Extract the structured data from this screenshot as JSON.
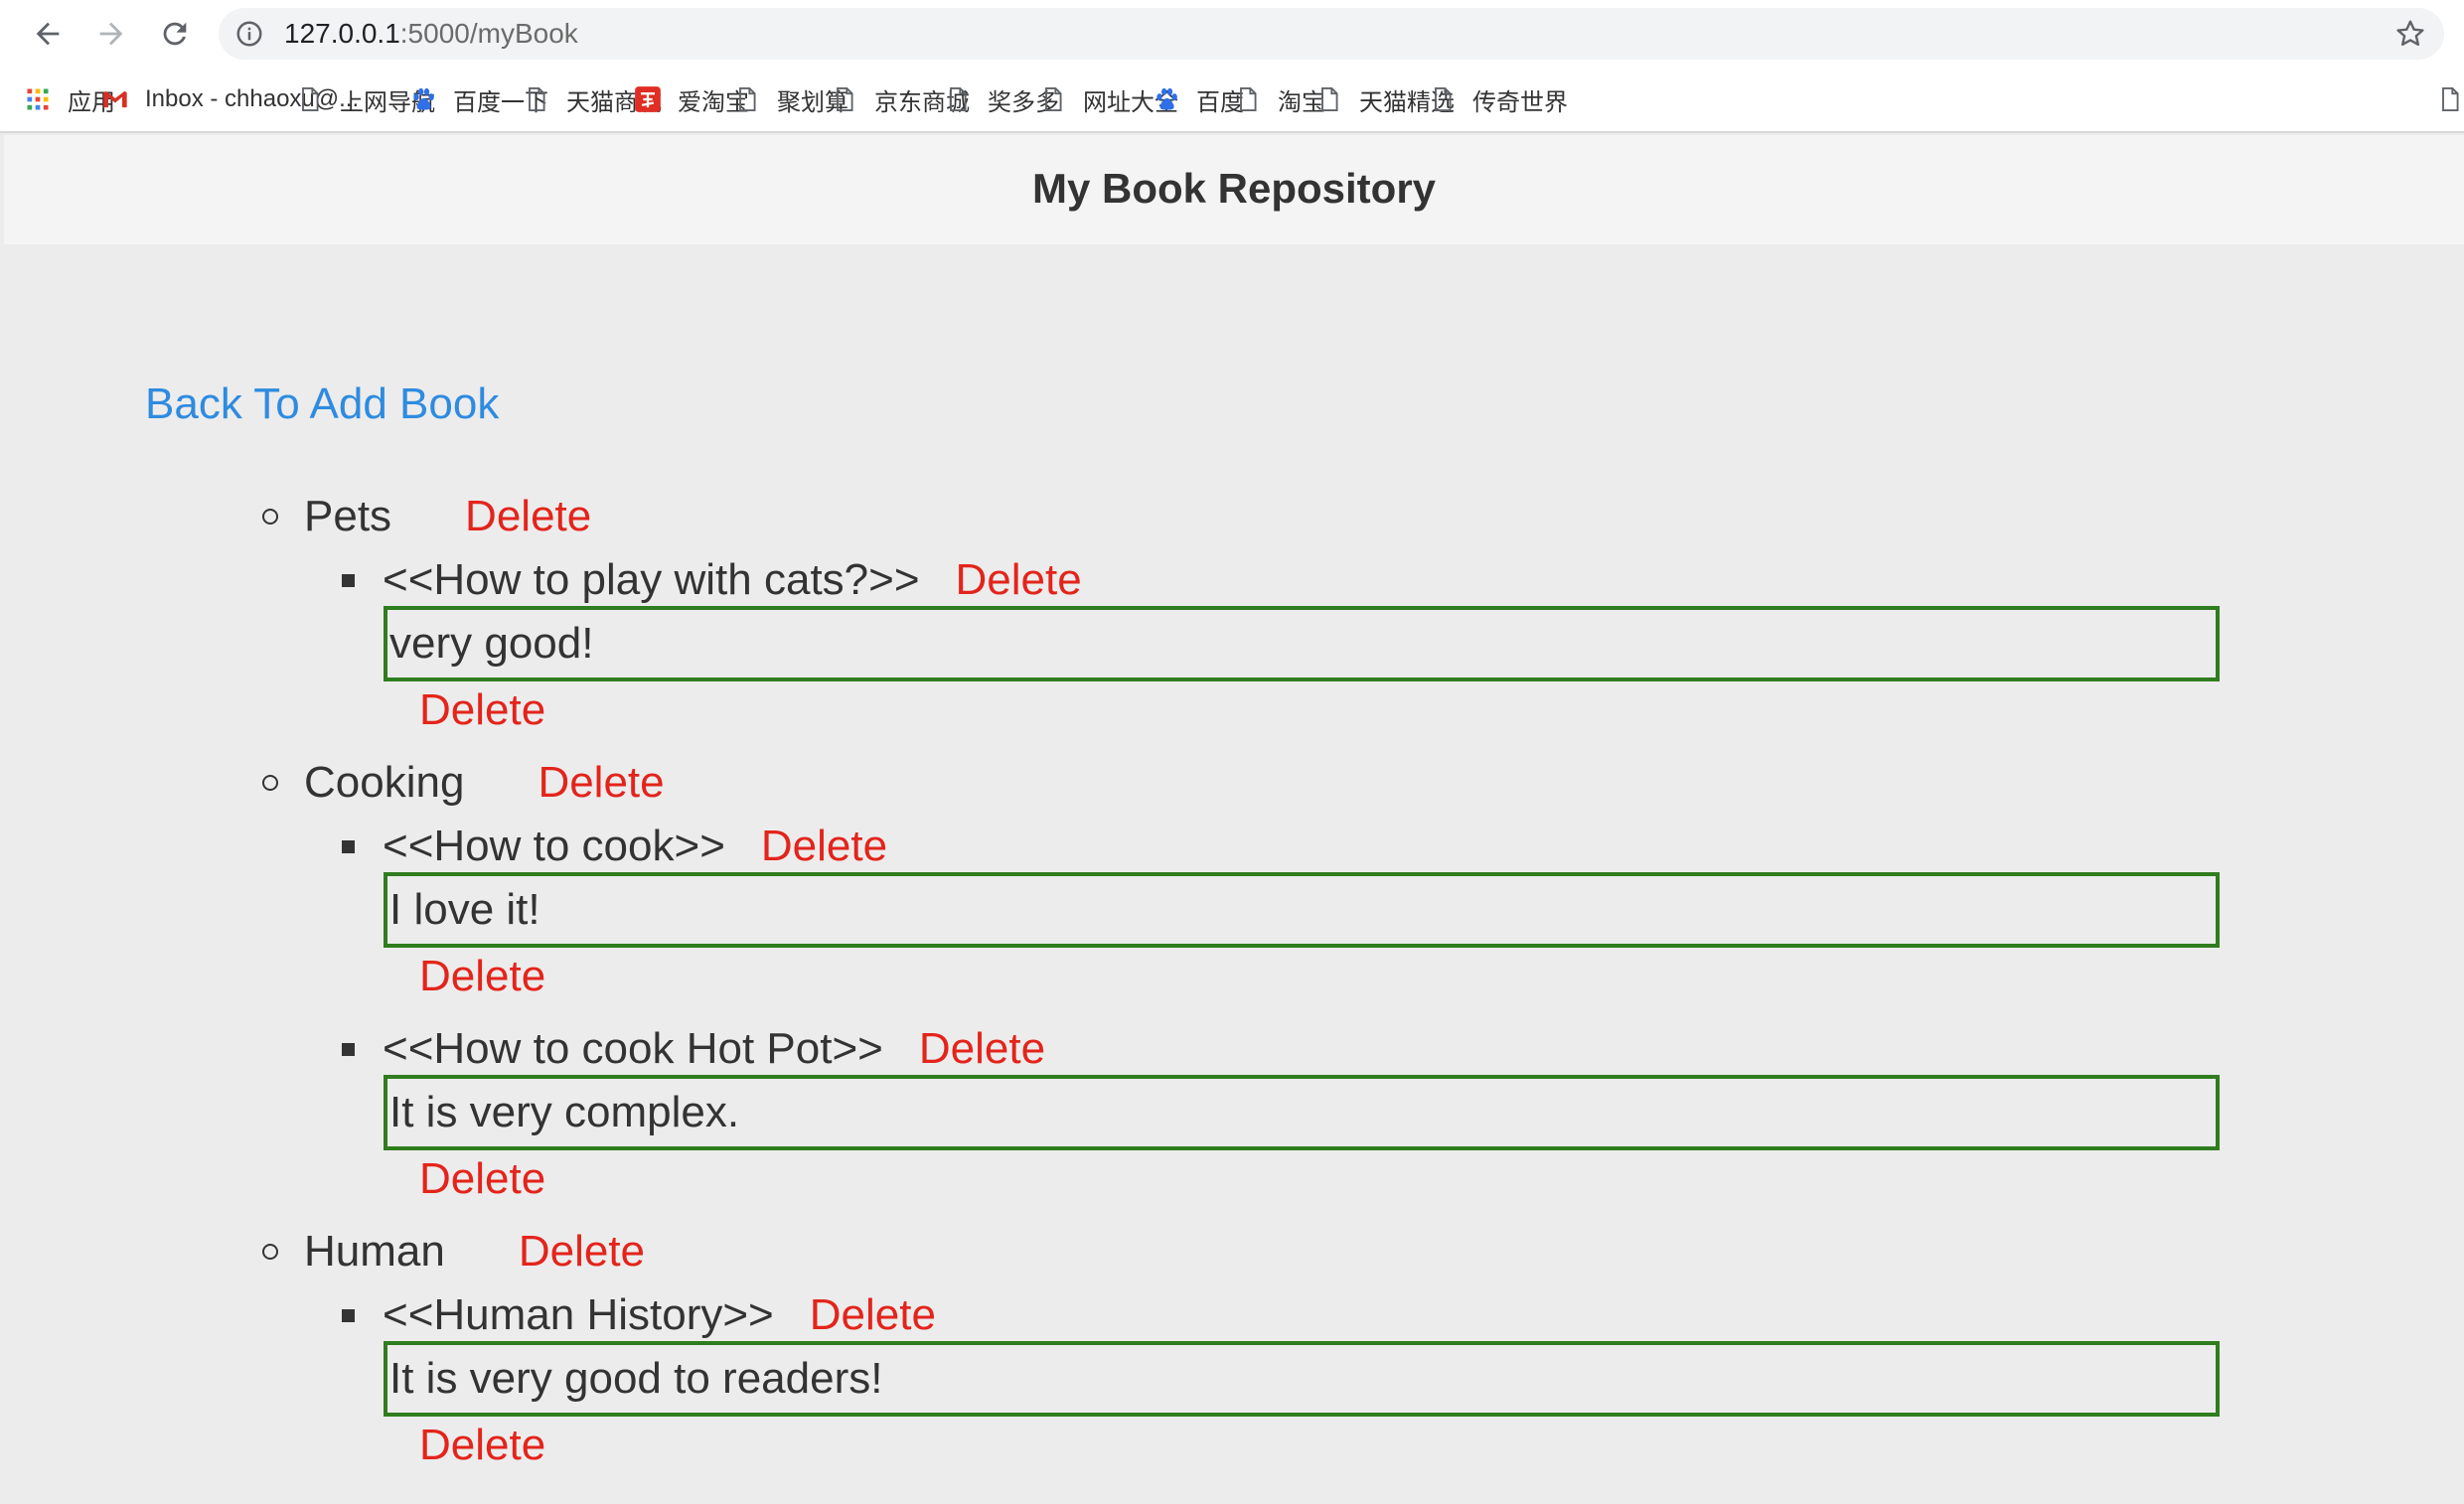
{
  "browser": {
    "url_host": "127.0.0.1",
    "url_path": ":5000/myBook",
    "bookmarks": [
      {
        "label": "应用",
        "icon": "apps-grid-icon"
      },
      {
        "label": "Inbox - chhaoxu@...",
        "icon": "gmail-icon"
      },
      {
        "label": "上网导航",
        "icon": "page-icon"
      },
      {
        "label": "百度一下",
        "icon": "baidu-paw-icon"
      },
      {
        "label": "天猫商城",
        "icon": "page-icon"
      },
      {
        "label": "爱淘宝",
        "icon": "taobao-icon"
      },
      {
        "label": "聚划算",
        "icon": "page-icon"
      },
      {
        "label": "京东商城",
        "icon": "page-icon"
      },
      {
        "label": "奖多多",
        "icon": "page-icon"
      },
      {
        "label": "网址大全",
        "icon": "page-icon"
      },
      {
        "label": "百度",
        "icon": "baidu-paw-icon"
      },
      {
        "label": "淘宝",
        "icon": "page-icon"
      },
      {
        "label": "天猫精选",
        "icon": "page-icon"
      },
      {
        "label": "传奇世界",
        "icon": "page-icon"
      }
    ]
  },
  "page": {
    "title": "My Book Repository",
    "back_link": "Back To Add Book",
    "delete_label": "Delete",
    "categories": [
      {
        "name": "Pets",
        "books": [
          {
            "title": "<<How to play with cats?>>",
            "comment": "very good!"
          }
        ]
      },
      {
        "name": "Cooking",
        "books": [
          {
            "title": "<<How to cook>>",
            "comment": "I love it!"
          },
          {
            "title": "<<How to cook Hot Pot>>",
            "comment": "It is very complex."
          }
        ]
      },
      {
        "name": "Human",
        "books": [
          {
            "title": "<<Human History>>",
            "comment": "It is very good to readers!"
          }
        ]
      }
    ]
  },
  "colors": {
    "link": "#2e8be0",
    "delete": "#e3241b",
    "comment_border": "#2f7d1e",
    "page_bg": "#ececec"
  }
}
